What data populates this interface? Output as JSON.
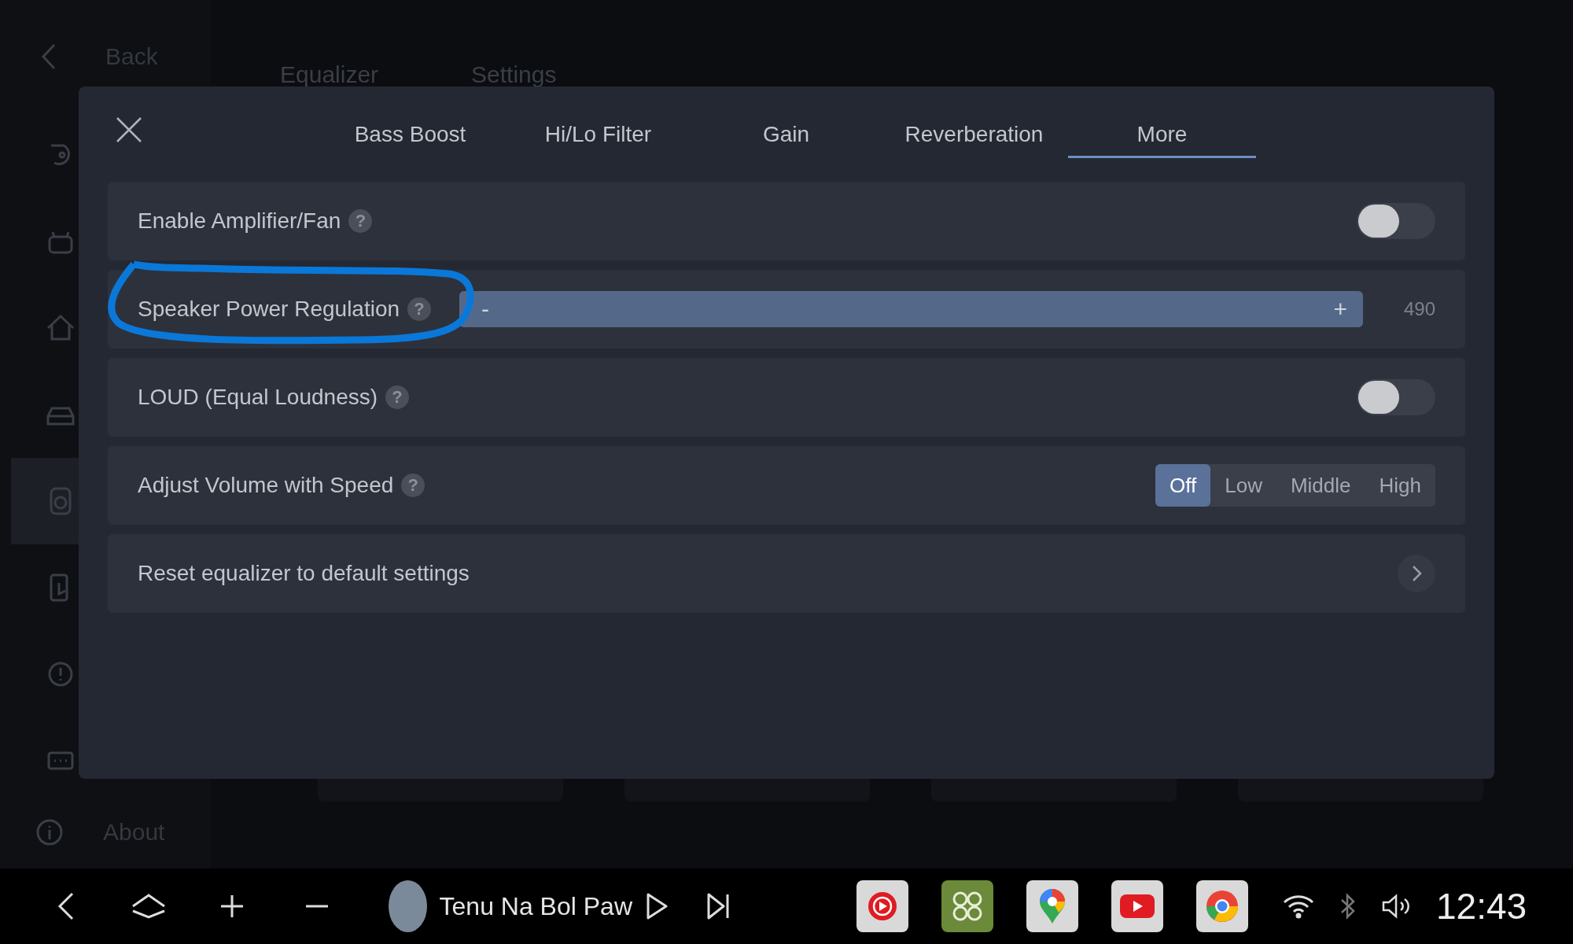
{
  "sidebar": {
    "back": {
      "label": "Back"
    },
    "items": [
      {
        "selected": false
      },
      {
        "selected": false
      },
      {
        "selected": false
      },
      {
        "selected": false
      },
      {
        "selected": true
      },
      {
        "selected": false
      },
      {
        "selected": false
      },
      {
        "selected": false
      }
    ],
    "about": {
      "label": "About"
    }
  },
  "background_tabs": [
    {
      "label": "Equalizer"
    },
    {
      "label": "Settings"
    }
  ],
  "dialog": {
    "tabs": [
      {
        "label": "Bass Boost",
        "selected": false
      },
      {
        "label": "Hi/Lo Filter",
        "selected": false
      },
      {
        "label": "Gain",
        "selected": false
      },
      {
        "label": "Reverberation",
        "selected": false
      },
      {
        "label": "More",
        "selected": true
      }
    ],
    "rows": [
      {
        "kind": "toggle",
        "label": "Enable Amplifier/Fan",
        "help": "?",
        "on": false
      },
      {
        "kind": "slider",
        "label": "Speaker Power Regulation",
        "help": "?",
        "minus": "-",
        "plus": "+",
        "level": 1,
        "reading": "490"
      },
      {
        "kind": "toggle",
        "label": "LOUD (Equal Loudness)",
        "help": "?",
        "on": false
      },
      {
        "kind": "segmented",
        "label": "Adjust Volume with Speed",
        "help": "?",
        "options": [
          {
            "label": "Off",
            "selected": true
          },
          {
            "label": "Low",
            "selected": false
          },
          {
            "label": "Middle",
            "selected": false
          },
          {
            "label": "High",
            "selected": false
          }
        ]
      },
      {
        "kind": "link",
        "label": "Reset equalizer to default settings"
      }
    ]
  },
  "taskbar": {
    "track_title": "Tenu Na Bol Paw",
    "time": "12:43"
  }
}
